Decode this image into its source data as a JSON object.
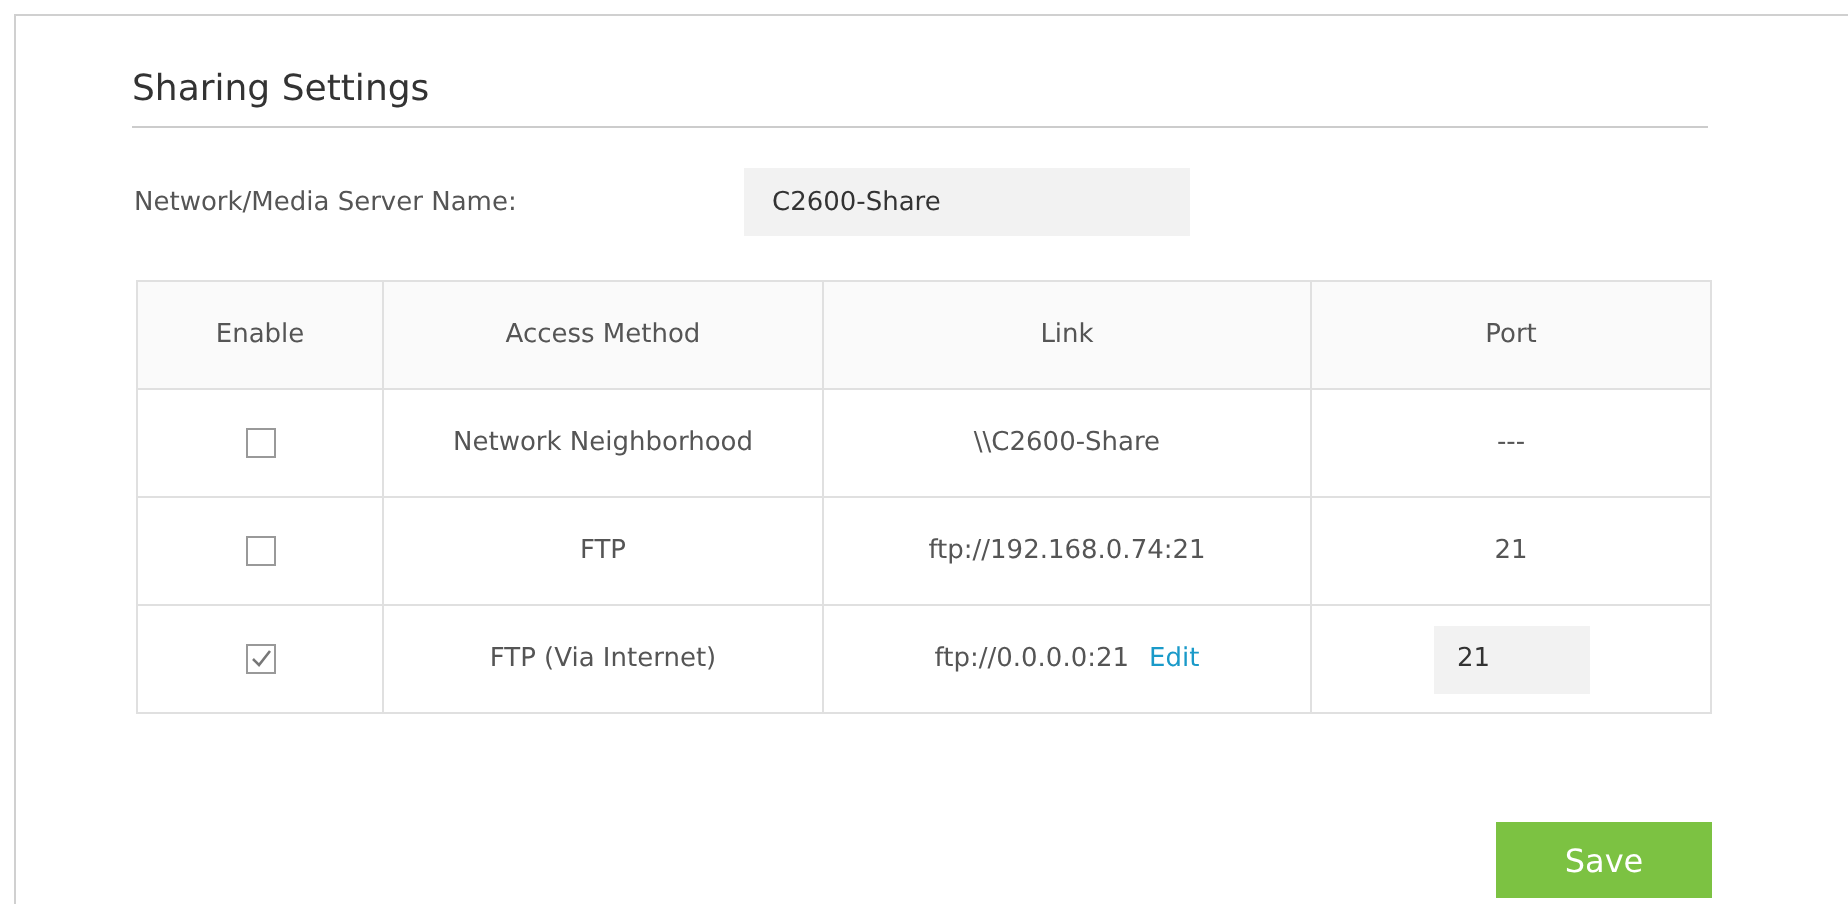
{
  "title": "Sharing Settings",
  "server_name": {
    "label": "Network/Media Server Name:",
    "value": "C2600-Share"
  },
  "table": {
    "columns": [
      "Enable",
      "Access Method",
      "Link",
      "Port"
    ],
    "rows": [
      {
        "checked": false,
        "method": "Network Neighborhood",
        "link": "\\\\C2600-Share",
        "port": {
          "kind": "text",
          "value": "---"
        }
      },
      {
        "checked": false,
        "method": "FTP",
        "link": "ftp://192.168.0.74:21",
        "port": {
          "kind": "text",
          "value": "21"
        }
      },
      {
        "checked": true,
        "method": "FTP (Via Internet)",
        "link": "ftp://0.0.0.0:21",
        "link_action": "Edit",
        "port": {
          "kind": "input",
          "value": "21"
        }
      }
    ]
  },
  "save_button": "Save"
}
